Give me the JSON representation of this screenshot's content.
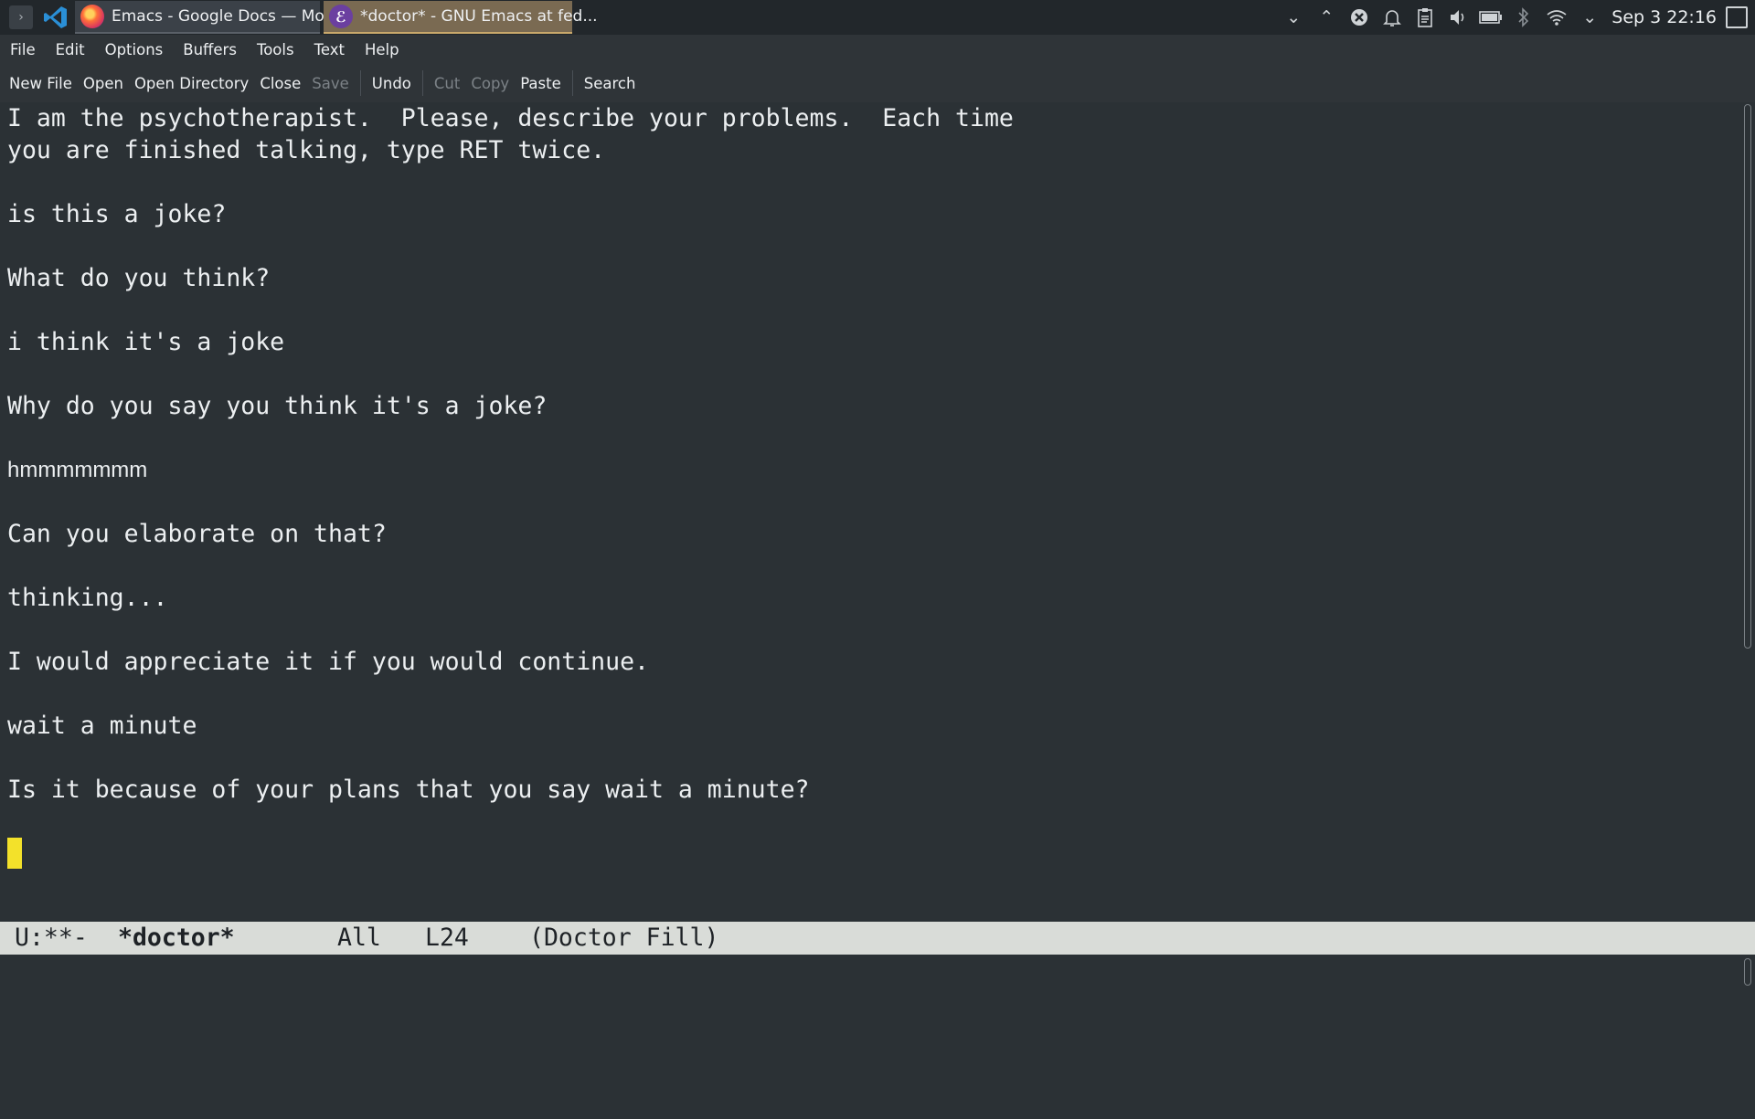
{
  "taskbar": {
    "tasks": [
      {
        "label": "Emacs - Google Docs — Mozi...",
        "app": "firefox"
      },
      {
        "label": "*doctor* - GNU Emacs at fed...",
        "app": "emacs"
      }
    ],
    "clock": "Sep 3 22:16",
    "tray_icons": [
      "chevron-down-icon",
      "chevron-up-icon",
      "close-circle-icon",
      "alarm-icon",
      "clipboard-icon",
      "volume-icon",
      "battery-icon",
      "bluetooth-icon",
      "wifi-icon",
      "expand-icon"
    ]
  },
  "menubar": {
    "items": [
      "File",
      "Edit",
      "Options",
      "Buffers",
      "Tools",
      "Text",
      "Help"
    ]
  },
  "toolbar": {
    "new_file": "New File",
    "open": "Open",
    "open_directory": "Open Directory",
    "close": "Close",
    "save": "Save",
    "undo": "Undo",
    "cut": "Cut",
    "copy": "Copy",
    "paste": "Paste",
    "search": "Search"
  },
  "buffer": {
    "lines": [
      "I am the psychotherapist.  Please, describe your problems.  Each time",
      "you are finished talking, type RET twice.",
      "is this a joke?",
      "What do you think?",
      "i think it's a joke",
      "Why do you say you think it's a joke?",
      "hmmmmmmm",
      "Can you elaborate on that?",
      "thinking...",
      "I would appreciate it if you would continue.",
      "wait a minute",
      "Is it because of your plans that you say wait a minute?"
    ]
  },
  "modeline": {
    "status": "U:**-",
    "buffer_name": "*doctor*",
    "position": "All",
    "line": "L24",
    "modes": "(Doctor Fill)"
  },
  "colors": {
    "background": "#2b3135",
    "cursor": "#f3e12a",
    "modeline_bg": "#d9dcd8",
    "emacs_task_bg": "#7a6a52"
  }
}
